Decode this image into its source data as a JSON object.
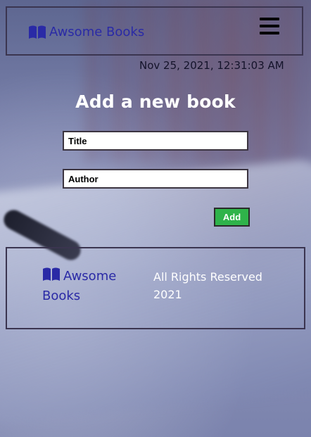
{
  "brand": {
    "name": "Awsome Books",
    "icon": "open-book-icon",
    "color": "#2a2aa6"
  },
  "header": {
    "menu_icon": "hamburger-menu-icon"
  },
  "datetime": "Nov 25, 2021, 12:31:03 AM",
  "form": {
    "title": "Add a new book",
    "title_placeholder": "Title",
    "author_placeholder": "Author",
    "add_label": "Add",
    "add_color": "#2fb34a"
  },
  "footer": {
    "brand_line1": "Awsome",
    "brand_line2": "Books",
    "rights_line1": "All Rights Reserved",
    "rights_line2": "2021"
  }
}
